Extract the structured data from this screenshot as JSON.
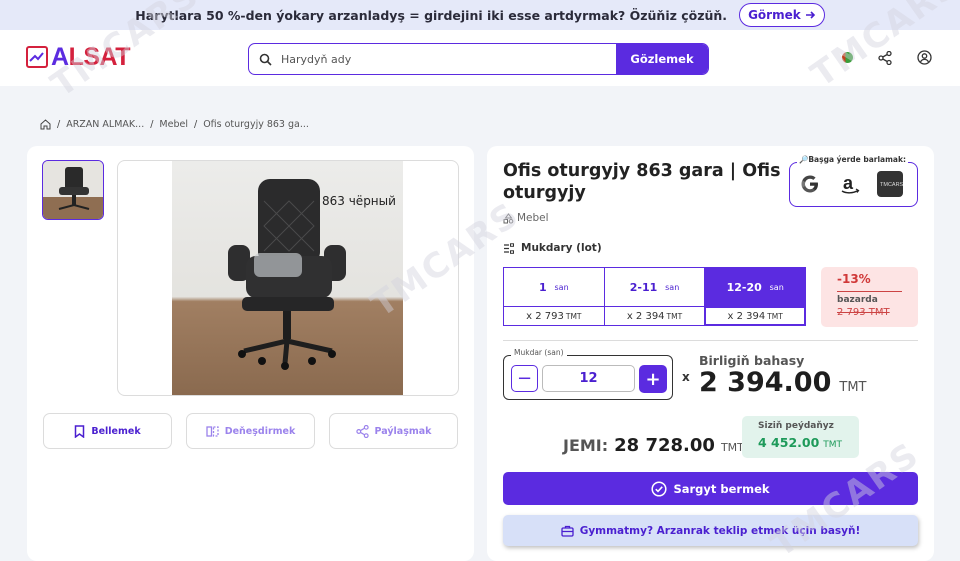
{
  "promo": {
    "text": "Harytlara 50 %-den ýokary arzanladyş = girdejini iki esse artdyrmak? Özüňiz çözüň.",
    "button_label": "Görmek"
  },
  "header": {
    "logo": "ALSAT",
    "search_placeholder": "Harydyň ady",
    "search_button": "Gözlemek"
  },
  "breadcrumb": [
    "ARZAN ALMAK...",
    "Mebel",
    "Ofis oturgyjy 863 ga..."
  ],
  "gallery": {
    "photo_label": "863 чёрный",
    "actions": [
      {
        "label": "Bellemek",
        "icon": "bookmark-icon"
      },
      {
        "label": "Deňeşdirmek",
        "icon": "compare-icon"
      },
      {
        "label": "Paýlaşmak",
        "icon": "share-icon"
      }
    ]
  },
  "product": {
    "title": "Ofis oturgyjy 863 gara | Ofis oturgyjy",
    "category": "Mebel",
    "search_elsewhere_label": "🔎Başga ýerde barlamak:",
    "search_elsewhere_icons": [
      "google-icon",
      "amazon-icon",
      "tmcars-icon"
    ],
    "quantity_heading": "Mukdary (lot)",
    "tiers": [
      {
        "range": "1",
        "unit": "san",
        "price": "x 2 793",
        "currency": "TMT"
      },
      {
        "range": "2-11",
        "unit": "san",
        "price": "x 2 394",
        "currency": "TMT"
      },
      {
        "range": "12-20",
        "unit": "san",
        "price": "x 2 394",
        "currency": "TMT"
      }
    ],
    "selected_tier": 2,
    "discount": {
      "percent": "-13%",
      "label": "bazarda",
      "old_price": "2 793 TMT"
    },
    "stepper_label": "Mukdar (san)",
    "quantity": "12",
    "times": "x",
    "unit_price_label": "Birligiň bahasy",
    "unit_price": "2 394.00",
    "currency": "TMT",
    "total_label": "JEMI:",
    "total": "28 728.00",
    "savings_label": "Siziň peýdaňyz",
    "savings": "4 452.00",
    "order_button": "Sargyt bermek",
    "offer_button": "Gymmatmy? Arzanrak teklip etmek üçin basyň!"
  },
  "colors": {
    "accent": "#5b2be0",
    "brand_red": "#d4213d",
    "discount": "#d03838",
    "savings": "#1e9a5a"
  },
  "watermark": "TMCARS"
}
